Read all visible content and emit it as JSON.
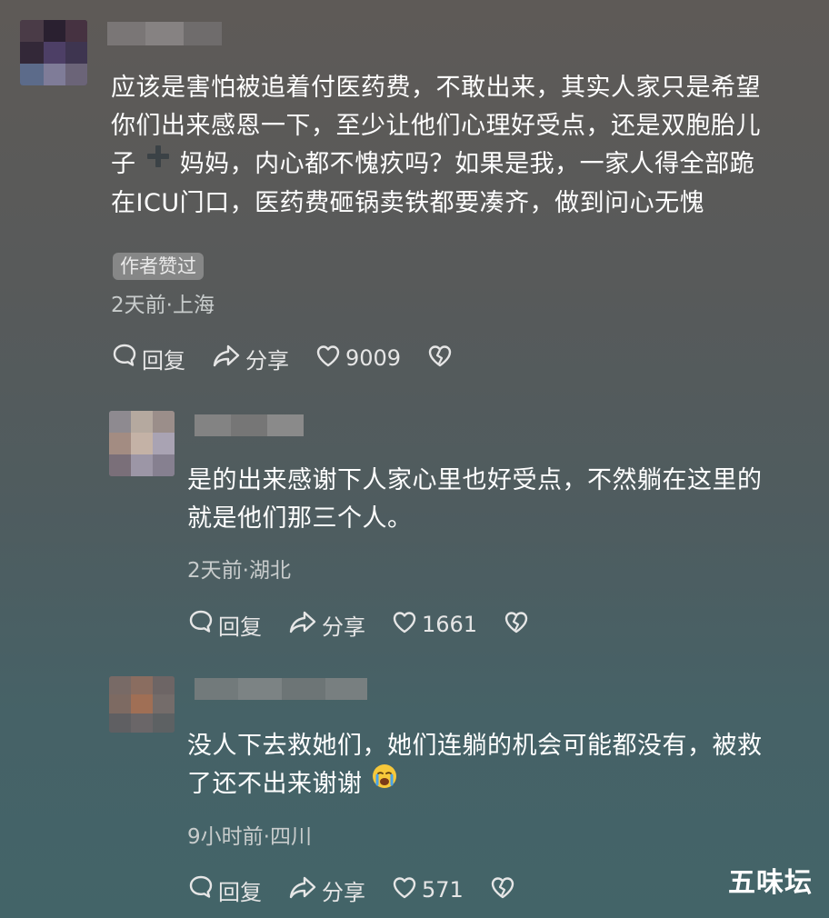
{
  "comments": [
    {
      "text_lines": [
        "应该是害怕被追着付医药费，不敢出来，其实人家只是希望",
        "你们出来感恩一下，至少让他们心理好受点，还是双胞胎儿",
        "子",
        "妈妈，内心都不愧疚吗？如果是我，一家人得全部跪",
        "在ICU门口，医药费砸锅卖铁都要凑齐，做到问心无愧"
      ],
      "badge": "作者赞过",
      "meta": "2天前·上海",
      "reply_label": "回复",
      "share_label": "分享",
      "likes": "9009"
    },
    {
      "text_lines": [
        "是的出来感谢下人家心里也好受点，不然躺在这里的",
        "就是他们那三个人。"
      ],
      "meta": "2天前·湖北",
      "reply_label": "回复",
      "share_label": "分享",
      "likes": "1661"
    },
    {
      "text_lines": [
        "没人下去救她们，她们连躺的机会可能都没有，被救",
        "了还不出来谢谢"
      ],
      "meta": "9小时前·四川",
      "reply_label": "回复",
      "share_label": "分享",
      "likes": "571"
    }
  ],
  "watermark": "五味坛",
  "icons": {
    "inline_1": "plus-icon",
    "inline_2": "crying-face-emoji",
    "reply": "comment-bubble-icon",
    "share": "share-arrow-icon",
    "like": "heart-icon",
    "dislike": "broken-heart-icon"
  }
}
